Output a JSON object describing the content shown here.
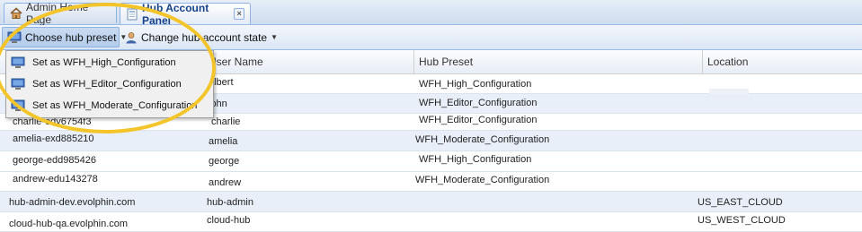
{
  "tabs": [
    {
      "label": "Admin Home Page",
      "icon": "home-icon"
    },
    {
      "label": "Hub Account Panel",
      "icon": "document-icon",
      "close": "×"
    }
  ],
  "toolbar": {
    "preset_label": "Choose hub preset",
    "preset_icon": "monitor-icon",
    "state_label": "Change hub account state",
    "state_icon": "user-icon"
  },
  "grid": {
    "columns": [
      "",
      "User Name",
      "Hub Preset",
      "Location"
    ],
    "rows": [
      {
        "account": "",
        "user": "albert",
        "preset": "WFH_High_Configuration",
        "location": ""
      },
      {
        "account": "",
        "user": "john",
        "preset": "WFH_Editor_Configuration",
        "location": ""
      },
      {
        "account": "charlie-edy6754f3",
        "user": "charlie",
        "preset": "WFH_Editor_Configuration",
        "location": ""
      },
      {
        "account": "amelia-exd885210",
        "user": "amelia",
        "preset": "WFH_Moderate_Configuration",
        "location": ""
      },
      {
        "account": "george-edd985426",
        "user": "george",
        "preset": "WFH_High_Configuration",
        "location": ""
      },
      {
        "account": "andrew-edu143278",
        "user": "andrew",
        "preset": "WFH_Moderate_Configuration",
        "location": ""
      },
      {
        "account": "hub-admin-dev.evolphin.com",
        "user": "hub-admin",
        "preset": "",
        "location": "US_EAST_CLOUD"
      },
      {
        "account": "cloud-hub-qa.evolphin.com",
        "user": "cloud-hub",
        "preset": "",
        "location": "US_WEST_CLOUD"
      }
    ]
  },
  "menu": {
    "items": [
      {
        "label": "Set as WFH_High_Configuration"
      },
      {
        "label": "Set as WFH_Editor_Configuration"
      },
      {
        "label": "Set as WFH_Moderate_Configuration"
      }
    ]
  },
  "colors": {
    "highlight": "#f3c52a",
    "header_border": "#99bbe8",
    "alt_row": "#e8eff8"
  }
}
